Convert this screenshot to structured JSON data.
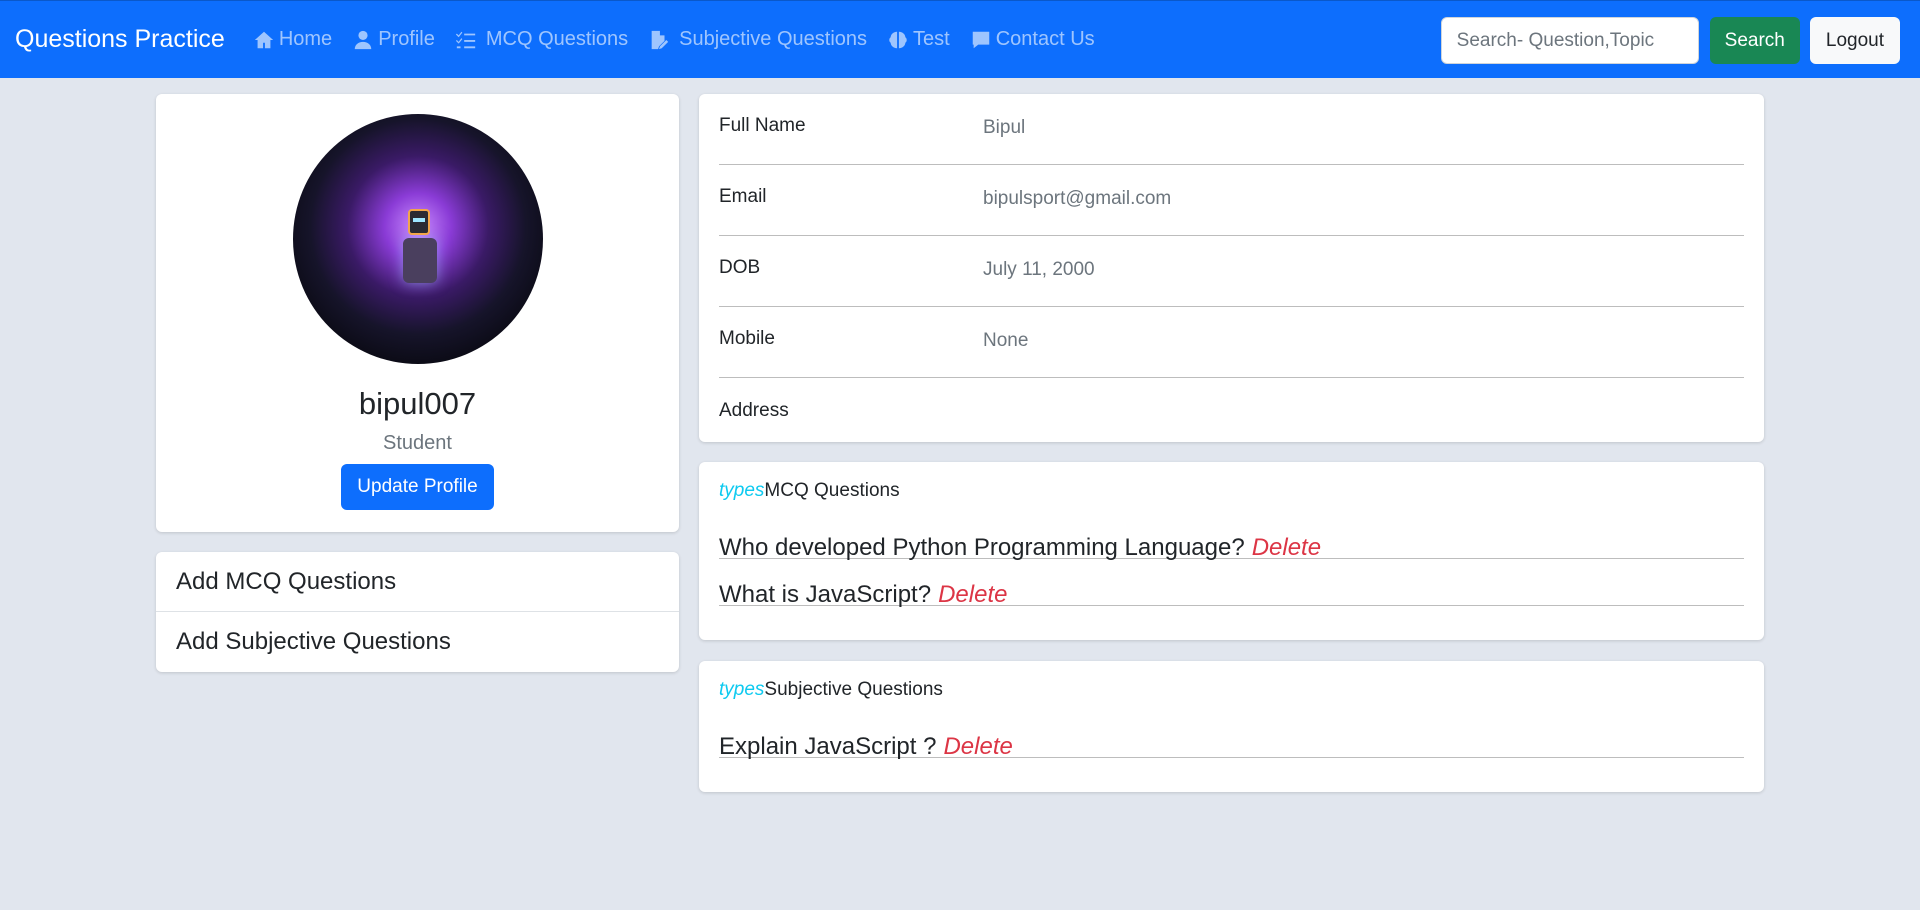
{
  "navbar": {
    "brand": "Questions Practice",
    "links": [
      {
        "label": "Home",
        "icon": "home-icon"
      },
      {
        "label": "Profile",
        "icon": "user-icon"
      },
      {
        "label": "MCQ Questions",
        "icon": "list-check-icon"
      },
      {
        "label": "Subjective Questions",
        "icon": "file-pen-icon"
      },
      {
        "label": "Test",
        "icon": "brain-icon"
      },
      {
        "label": "Contact Us",
        "icon": "message-icon"
      }
    ],
    "search_placeholder": "Search- Question,Topic",
    "search_button": "Search",
    "logout_button": "Logout"
  },
  "profile": {
    "username": "bipul007",
    "role": "Student",
    "update_button": "Update Profile"
  },
  "actions": {
    "add_mcq": "Add MCQ Questions",
    "add_subjective": "Add Subjective Questions"
  },
  "info": {
    "rows": [
      {
        "label": "Full Name",
        "value": "Bipul"
      },
      {
        "label": "Email",
        "value": "bipulsport@gmail.com"
      },
      {
        "label": "DOB",
        "value": "July 11, 2000"
      },
      {
        "label": "Mobile",
        "value": "None"
      },
      {
        "label": "Address",
        "value": ""
      }
    ]
  },
  "mcq": {
    "prefix": "types",
    "title": "MCQ Questions",
    "questions": [
      {
        "text": "Who developed Python Programming Language?",
        "action": "Delete"
      },
      {
        "text": "What is JavaScript?",
        "action": "Delete"
      }
    ]
  },
  "subjective": {
    "prefix": "types",
    "title": "Subjective Questions",
    "questions": [
      {
        "text": "Explain JavaScript ?",
        "action": "Delete"
      }
    ]
  },
  "colors": {
    "primary": "#0d6efd",
    "success": "#198754",
    "danger": "#dc3545",
    "info": "#0dcaf0",
    "background": "#e1e6ee"
  }
}
